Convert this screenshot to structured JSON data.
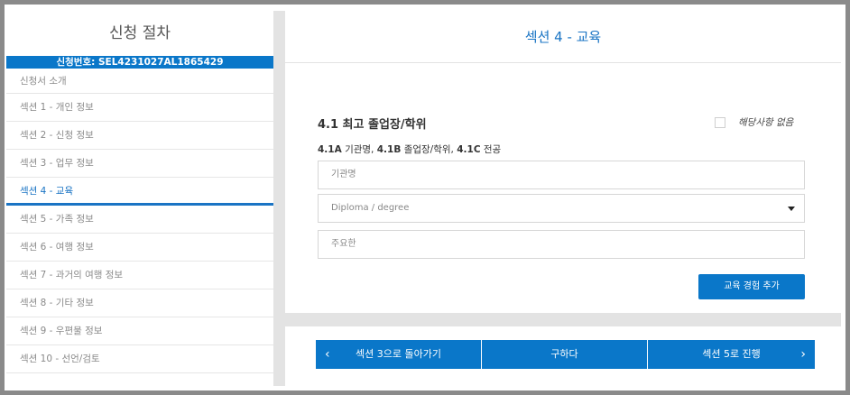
{
  "sidebar": {
    "title": "신청 절차",
    "application_number": "신청번호: SEL4231027AL1865429",
    "items": [
      {
        "label": "신청서 소개"
      },
      {
        "label": "섹션 1 - 개인 정보"
      },
      {
        "label": "섹션 2 - 신청 정보"
      },
      {
        "label": "섹션 3 - 업무 정보"
      },
      {
        "label": "섹션 4 - 교육"
      },
      {
        "label": "섹션 5 - 가족 정보"
      },
      {
        "label": "섹션 6 - 여행 정보"
      },
      {
        "label": "섹션 7 - 과거의 여행 정보"
      },
      {
        "label": "섹션 8 - 기타 정보"
      },
      {
        "label": "섹션 9 - 우편물 정보"
      },
      {
        "label": "섹션 10 - 선언/검토"
      }
    ],
    "active_index": 4
  },
  "main": {
    "header": "섹션 4 - 교육",
    "section_title": "4.1 최고 졸업장/학위",
    "not_applicable_label": "해당사항 없음",
    "sub_labels": {
      "a_code": "4.1A",
      "a_text": "기관명,",
      "b_code": "4.1B",
      "b_text": "졸업장/학위,",
      "c_code": "4.1C",
      "c_text": "전공"
    },
    "fields": {
      "institution_placeholder": "기관명",
      "degree_selected": "Diploma / degree",
      "major_placeholder": "주요한"
    },
    "add_button": "교육 경험 추가"
  },
  "footer": {
    "prev_label": "섹션 3으로 돌아가기",
    "save_label": "구하다",
    "next_label": "섹션 5로 진행",
    "prev_arrow": "‹",
    "next_arrow": "›"
  },
  "colors": {
    "accent": "#0a77c9",
    "link": "#1a74c4"
  }
}
